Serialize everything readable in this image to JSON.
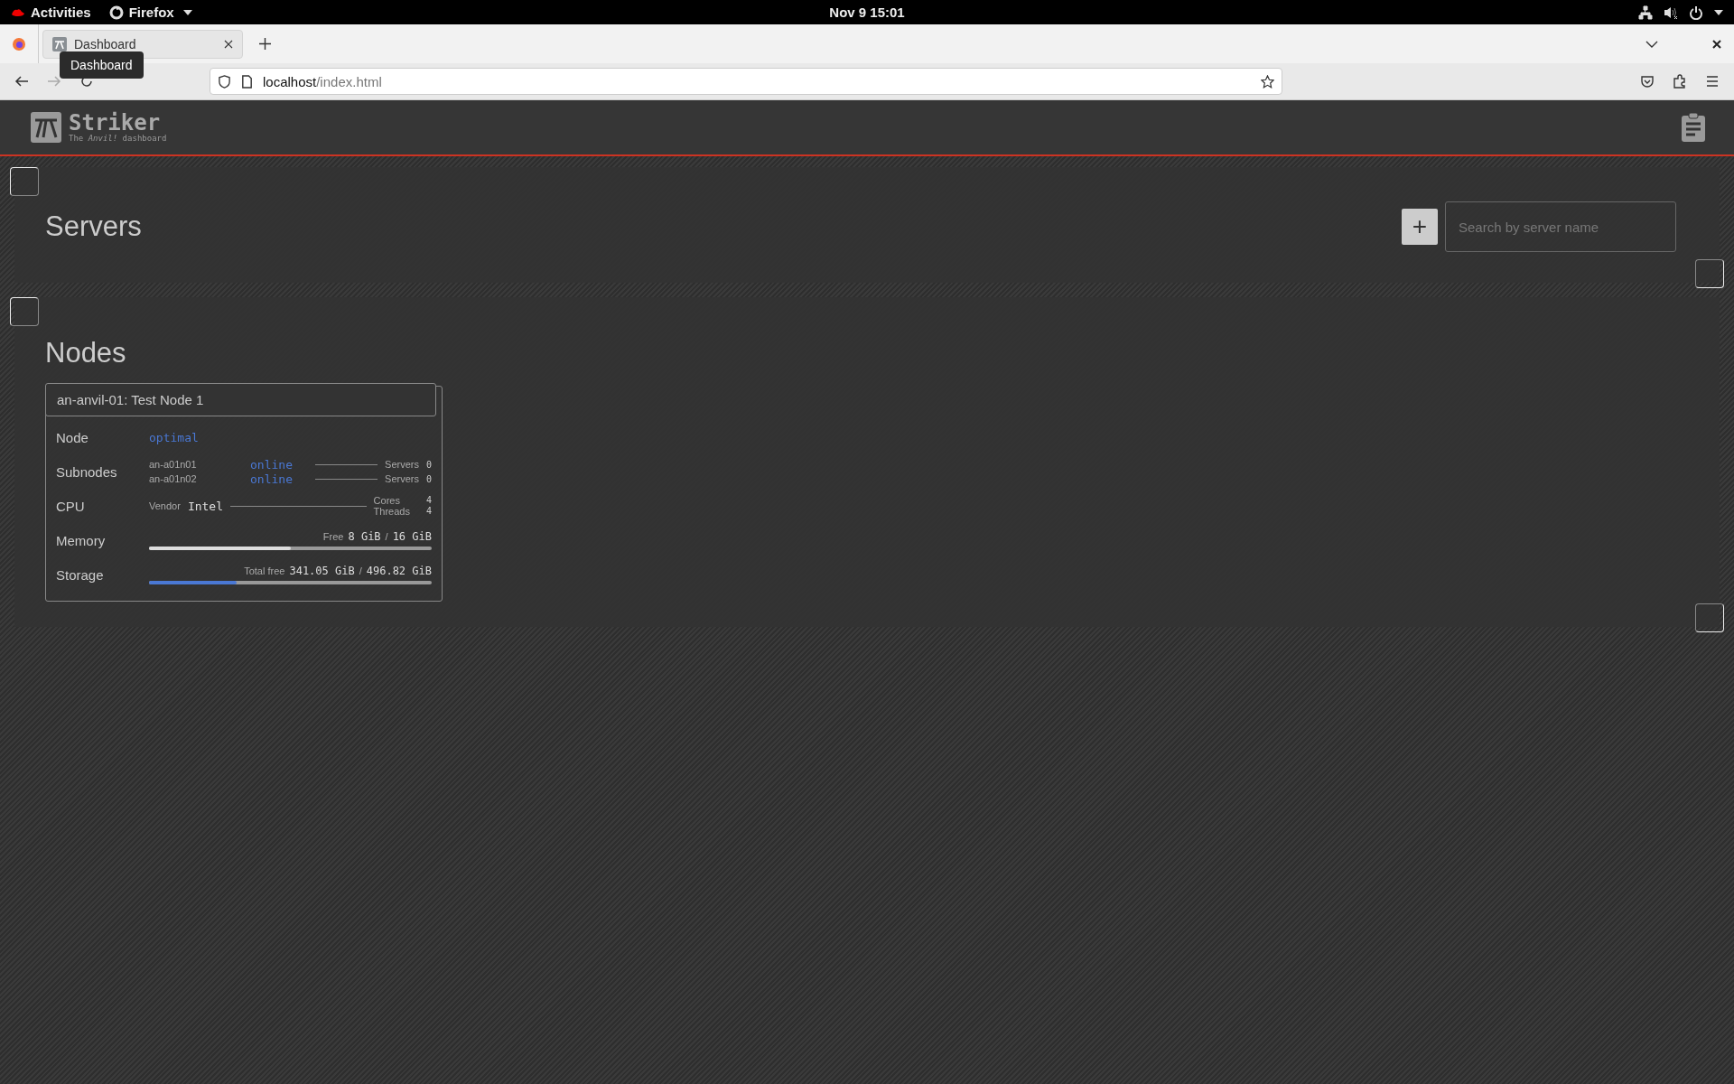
{
  "system_bar": {
    "activities": "Activities",
    "app": "Firefox",
    "clock": "Nov 9  15:01"
  },
  "browser": {
    "tabs": [
      {
        "title": "Dashboard",
        "selected": true
      }
    ],
    "tooltip": "Dashboard",
    "url": {
      "host": "localhost",
      "path": "/index.html"
    }
  },
  "header": {
    "title": "Striker",
    "subtitle": "The *Anvil!* dashboard"
  },
  "servers": {
    "title": "Servers",
    "add_button": "+",
    "search": {
      "placeholder": "Search by server name"
    }
  },
  "nodes": {
    "title": "Nodes",
    "cards": [
      {
        "name": "an-anvil-01: Test Node 1",
        "node": {
          "label": "Node",
          "status": "optimal"
        },
        "subnodes": {
          "label": "Subnodes",
          "items": [
            {
              "name": "an-a01n01",
              "status": "online",
              "servers_label": "Servers",
              "servers": "0"
            },
            {
              "name": "an-a01n02",
              "status": "online",
              "servers_label": "Servers",
              "servers": "0"
            }
          ]
        },
        "cpu": {
          "label": "CPU",
          "vendor_label": "Vendor",
          "vendor": "Intel",
          "cores_label": "Cores",
          "cores": "4",
          "threads_label": "Threads",
          "threads": "4"
        },
        "memory": {
          "label": "Memory",
          "free_label": "Free",
          "free": "8 GiB",
          "separator": "/",
          "total": "16 GiB",
          "level": 0.5
        },
        "storage": {
          "label": "Storage",
          "free_label": "Total free",
          "free": "341.05 GiB",
          "separator": "/",
          "total": "496.82 GiB",
          "level": 0.31
        }
      }
    ]
  }
}
